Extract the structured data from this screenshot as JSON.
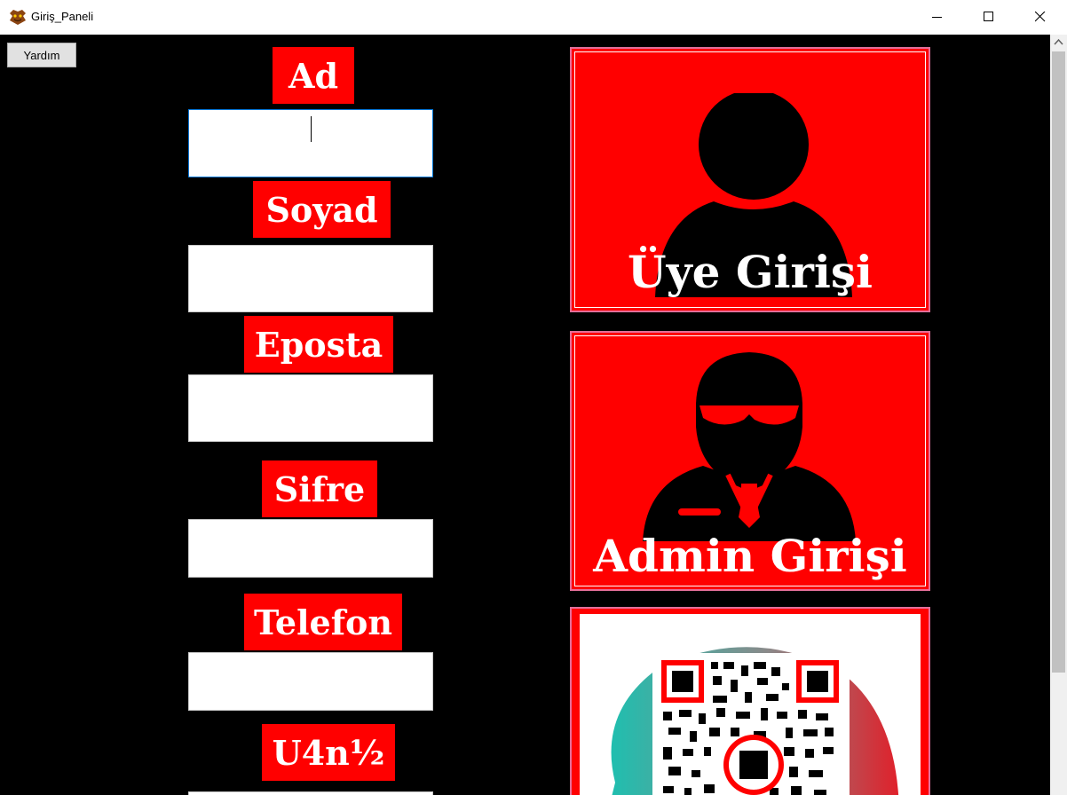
{
  "window": {
    "title": "Giriş_Paneli"
  },
  "toolbar": {
    "help_label": "Yardım"
  },
  "form": {
    "fields": [
      {
        "label": "Ad",
        "value": ""
      },
      {
        "label": "Soyad",
        "value": ""
      },
      {
        "label": "Eposta",
        "value": ""
      },
      {
        "label": "Sifre",
        "value": ""
      },
      {
        "label": "Telefon",
        "value": ""
      },
      {
        "label": "U4n½",
        "value": ""
      }
    ]
  },
  "panels": {
    "member_login": {
      "label": "Üye Girişi",
      "icon": "user-icon"
    },
    "admin_login": {
      "label": "Admin Girişi",
      "icon": "admin-icon"
    },
    "qr": {
      "icon": "qr-code-icon"
    }
  },
  "colors": {
    "accent": "#ff0000",
    "background": "#000000",
    "text": "#ffffff"
  }
}
